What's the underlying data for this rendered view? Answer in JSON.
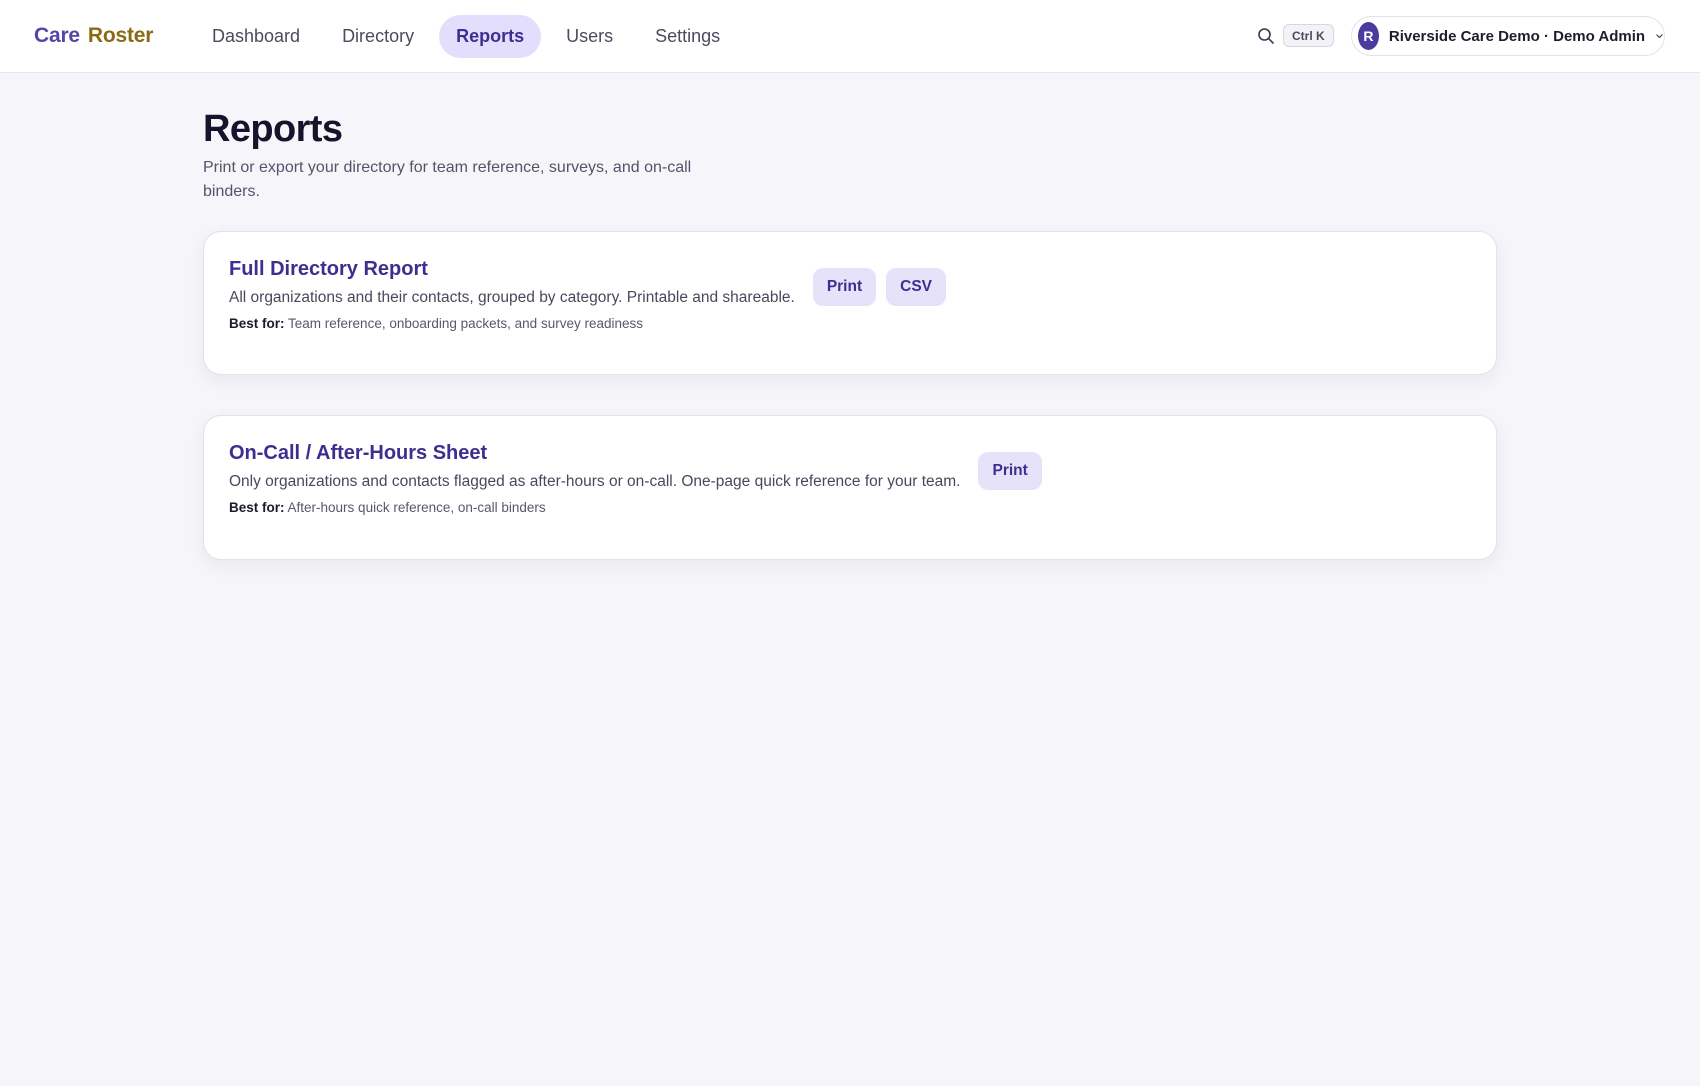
{
  "brand": {
    "part1": "Care",
    "part2": "Roster"
  },
  "nav": {
    "items": [
      {
        "label": "Dashboard",
        "active": false
      },
      {
        "label": "Directory",
        "active": false
      },
      {
        "label": "Reports",
        "active": true
      },
      {
        "label": "Users",
        "active": false
      },
      {
        "label": "Settings",
        "active": false
      }
    ]
  },
  "search": {
    "icon": "search-icon",
    "shortcut": "Ctrl K"
  },
  "account": {
    "avatar_initial": "R",
    "label": "Riverside Care Demo · Demo Admin",
    "icon": "chevron-down-icon"
  },
  "page": {
    "title": "Reports",
    "subtitle": "Print or export your directory for team reference, surveys, and on-call binders."
  },
  "reports": [
    {
      "title": "Full Directory Report",
      "description": "All organizations and their contacts, grouped by category. Printable and shareable.",
      "best_for_label": "Best for:",
      "best_for": "Team reference, onboarding packets, and survey readiness",
      "actions": [
        "Print",
        "CSV"
      ]
    },
    {
      "title": "On-Call / After-Hours Sheet",
      "description": "Only organizations and contacts flagged as after-hours or on-call. One-page quick reference for your team.",
      "best_for_label": "Best for:",
      "best_for": "After-hours quick reference, on-call binders",
      "actions": [
        "Print"
      ]
    }
  ],
  "colors": {
    "accent": "#3d2f8f",
    "accent_bg": "#e3defb",
    "brand_care": "#5644a8",
    "brand_roster": "#8b6a14",
    "page_bg": "#f6f5f9"
  }
}
